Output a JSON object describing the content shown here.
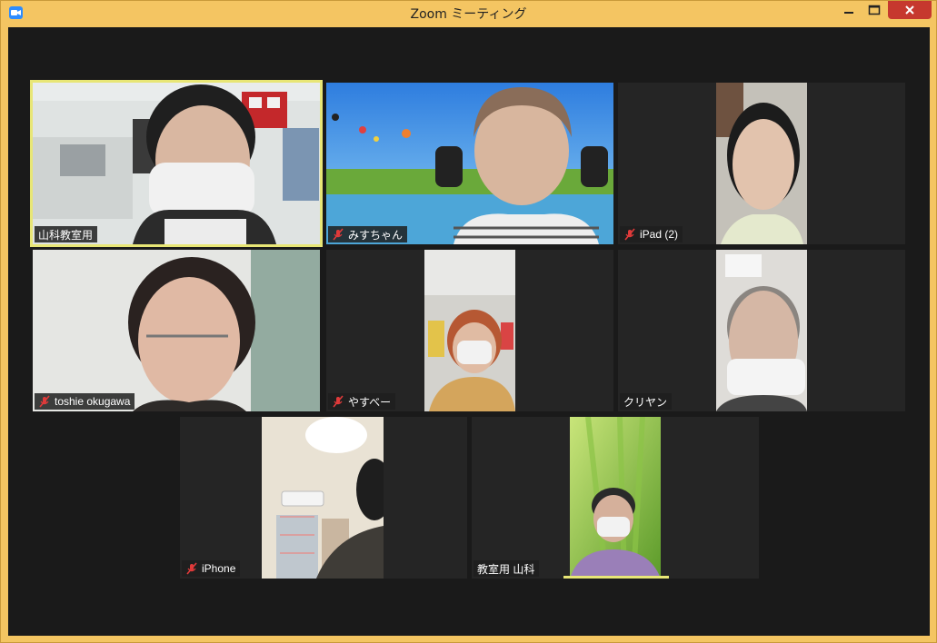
{
  "window": {
    "title": "Zoom ミーティング",
    "app_icon": "zoom-camera-icon",
    "controls": [
      "minimize-icon",
      "maximize-icon",
      "close-icon"
    ],
    "colors": {
      "frame": "#f4c562",
      "close": "#c6382e",
      "background": "#1a1a1a",
      "active_speaker": "#e8e676"
    }
  },
  "participants": [
    {
      "name": "山科教室用",
      "muted": false,
      "active": true
    },
    {
      "name": "みすちゃん",
      "muted": true,
      "active": false
    },
    {
      "name": "iPad (2)",
      "muted": true,
      "active": false
    },
    {
      "name": "toshie okugawa",
      "muted": true,
      "active": false
    },
    {
      "name": "やすべー",
      "muted": true,
      "active": false
    },
    {
      "name": "クリヤン",
      "muted": false,
      "active": false
    },
    {
      "name": "iPhone",
      "muted": true,
      "active": false
    },
    {
      "name": "教室用 山科",
      "muted": false,
      "active": false,
      "speaking": true
    }
  ]
}
